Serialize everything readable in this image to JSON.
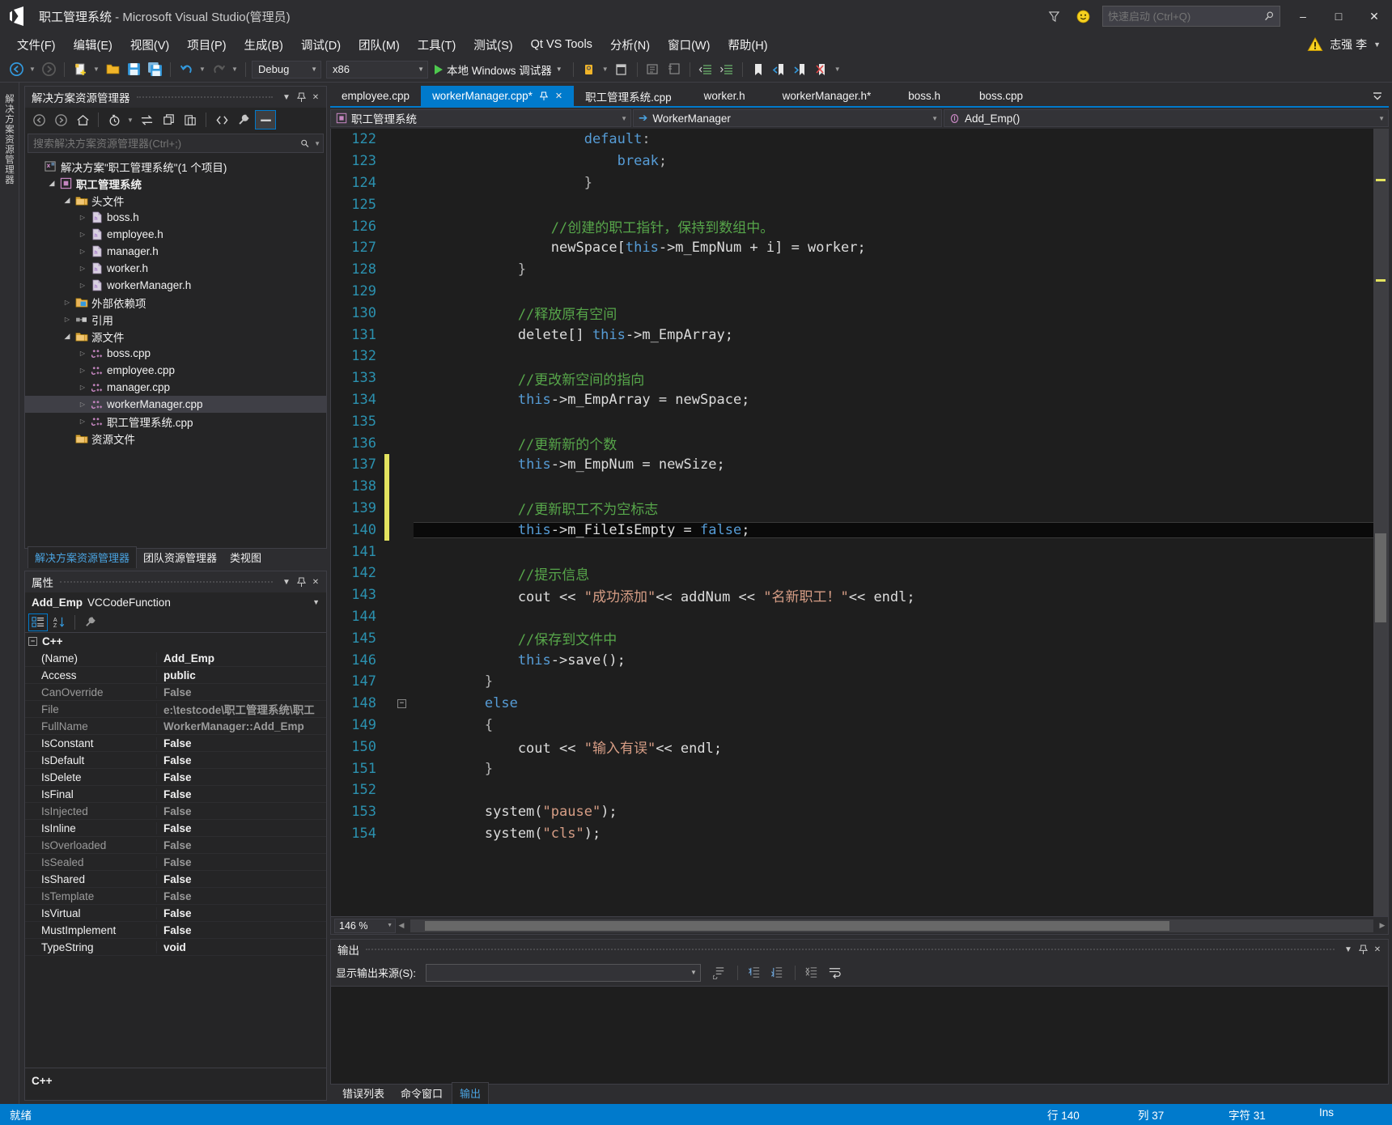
{
  "window": {
    "title_project": "职工管理系统",
    "title_suffix": " - Microsoft Visual Studio(管理员)",
    "minimize": "–",
    "maximize": "□",
    "close": "✕"
  },
  "quick_launch": {
    "placeholder": "快速启动 (Ctrl+Q)",
    "value": ""
  },
  "menu": {
    "items": [
      {
        "label": "文件(F)"
      },
      {
        "label": "编辑(E)"
      },
      {
        "label": "视图(V)"
      },
      {
        "label": "项目(P)"
      },
      {
        "label": "生成(B)"
      },
      {
        "label": "调试(D)"
      },
      {
        "label": "团队(M)"
      },
      {
        "label": "工具(T)"
      },
      {
        "label": "测试(S)"
      },
      {
        "label": "Qt VS Tools"
      },
      {
        "label": "分析(N)"
      },
      {
        "label": "窗口(W)"
      },
      {
        "label": "帮助(H)"
      }
    ],
    "user": "志强 李"
  },
  "toolbar": {
    "config": "Debug",
    "platform": "x86",
    "debug_target": "本地 Windows 调试器"
  },
  "solution_explorer": {
    "title": "解决方案资源管理器",
    "search_placeholder": "搜索解决方案资源管理器(Ctrl+;)",
    "search_value": "",
    "tree": [
      {
        "label": "解决方案\"职工管理系统\"(1 个项目)",
        "indent": 0,
        "arrow": "",
        "icon": "solution",
        "bold": false
      },
      {
        "label": "职工管理系统",
        "indent": 1,
        "arrow": "down",
        "icon": "project",
        "bold": true
      },
      {
        "label": "头文件",
        "indent": 2,
        "arrow": "down",
        "icon": "folder",
        "bold": false
      },
      {
        "label": "boss.h",
        "indent": 3,
        "arrow": "right",
        "icon": "header",
        "bold": false
      },
      {
        "label": "employee.h",
        "indent": 3,
        "arrow": "right",
        "icon": "header",
        "bold": false
      },
      {
        "label": "manager.h",
        "indent": 3,
        "arrow": "right",
        "icon": "header",
        "bold": false
      },
      {
        "label": "worker.h",
        "indent": 3,
        "arrow": "right",
        "icon": "header",
        "bold": false
      },
      {
        "label": "workerManager.h",
        "indent": 3,
        "arrow": "right",
        "icon": "header",
        "bold": false
      },
      {
        "label": "外部依赖项",
        "indent": 2,
        "arrow": "right",
        "icon": "extdep",
        "bold": false
      },
      {
        "label": "引用",
        "indent": 2,
        "arrow": "right",
        "icon": "refs",
        "bold": false
      },
      {
        "label": "源文件",
        "indent": 2,
        "arrow": "down",
        "icon": "folder",
        "bold": false
      },
      {
        "label": "boss.cpp",
        "indent": 3,
        "arrow": "right",
        "icon": "cpp",
        "bold": false
      },
      {
        "label": "employee.cpp",
        "indent": 3,
        "arrow": "right",
        "icon": "cpp",
        "bold": false
      },
      {
        "label": "manager.cpp",
        "indent": 3,
        "arrow": "right",
        "icon": "cpp",
        "bold": false
      },
      {
        "label": "workerManager.cpp",
        "indent": 3,
        "arrow": "right",
        "icon": "cpp",
        "bold": false,
        "selected": true
      },
      {
        "label": "职工管理系统.cpp",
        "indent": 3,
        "arrow": "right",
        "icon": "cpp",
        "bold": false
      },
      {
        "label": "资源文件",
        "indent": 2,
        "arrow": "",
        "icon": "folder",
        "bold": false
      }
    ],
    "dock_tabs": [
      {
        "label": "解决方案资源管理器",
        "active": true
      },
      {
        "label": "团队资源管理器",
        "active": false
      },
      {
        "label": "类视图",
        "active": false
      }
    ]
  },
  "properties": {
    "title": "属性",
    "object_name": "Add_Emp",
    "object_type": "VCCodeFunction",
    "category": "C++",
    "footer": "C++",
    "rows": [
      {
        "key": "(Name)",
        "value": "Add_Emp",
        "dim": false
      },
      {
        "key": "Access",
        "value": "public",
        "dim": false
      },
      {
        "key": "CanOverride",
        "value": "False",
        "dim": true
      },
      {
        "key": "File",
        "value": "e:\\testcode\\职工管理系统\\职工",
        "dim": true
      },
      {
        "key": "FullName",
        "value": "WorkerManager::Add_Emp",
        "dim": true
      },
      {
        "key": "IsConstant",
        "value": "False",
        "dim": false
      },
      {
        "key": "IsDefault",
        "value": "False",
        "dim": false
      },
      {
        "key": "IsDelete",
        "value": "False",
        "dim": false
      },
      {
        "key": "IsFinal",
        "value": "False",
        "dim": false
      },
      {
        "key": "IsInjected",
        "value": "False",
        "dim": true
      },
      {
        "key": "IsInline",
        "value": "False",
        "dim": false
      },
      {
        "key": "IsOverloaded",
        "value": "False",
        "dim": true
      },
      {
        "key": "IsSealed",
        "value": "False",
        "dim": true
      },
      {
        "key": "IsShared",
        "value": "False",
        "dim": false
      },
      {
        "key": "IsTemplate",
        "value": "False",
        "dim": true
      },
      {
        "key": "IsVirtual",
        "value": "False",
        "dim": false
      },
      {
        "key": "MustImplement",
        "value": "False",
        "dim": false
      },
      {
        "key": "TypeString",
        "value": "void",
        "dim": false
      }
    ]
  },
  "editor": {
    "tabs": [
      {
        "label": "employee.cpp",
        "active": false,
        "dirty": false
      },
      {
        "label": "workerManager.cpp*",
        "active": true,
        "dirty": true
      },
      {
        "label": "职工管理系统.cpp",
        "active": false,
        "dirty": false
      },
      {
        "label": "worker.h",
        "active": false,
        "dirty": false
      },
      {
        "label": "workerManager.h*",
        "active": false,
        "dirty": true
      },
      {
        "label": "boss.h",
        "active": false,
        "dirty": false
      },
      {
        "label": "boss.cpp",
        "active": false,
        "dirty": false
      }
    ],
    "nav_project": "职工管理系统",
    "nav_class": "WorkerManager",
    "nav_member": "Add_Emp()",
    "zoom": "146 %",
    "first_line": 122,
    "current_line": 140,
    "lines": [
      {
        "n": 122,
        "tokens": [
          {
            "t": "                    ",
            "c": "pl"
          },
          {
            "t": "default",
            "c": "kw"
          },
          {
            "t": ":",
            "c": "op"
          }
        ]
      },
      {
        "n": 123,
        "tokens": [
          {
            "t": "                        ",
            "c": "pl"
          },
          {
            "t": "break",
            "c": "kw"
          },
          {
            "t": ";",
            "c": "op"
          }
        ]
      },
      {
        "n": 124,
        "tokens": [
          {
            "t": "                    }",
            "c": "op"
          }
        ]
      },
      {
        "n": 125,
        "tokens": []
      },
      {
        "n": 126,
        "tokens": [
          {
            "t": "                //创建的职工指针，保持到数组中。",
            "c": "cm"
          }
        ]
      },
      {
        "n": 127,
        "tokens": [
          {
            "t": "                newSpace[",
            "c": "pl"
          },
          {
            "t": "this",
            "c": "kw"
          },
          {
            "t": "->m_EmpNum + i] = worker;",
            "c": "pl"
          }
        ]
      },
      {
        "n": 128,
        "tokens": [
          {
            "t": "            }",
            "c": "op"
          }
        ]
      },
      {
        "n": 129,
        "tokens": []
      },
      {
        "n": 130,
        "tokens": [
          {
            "t": "            //释放原有空间",
            "c": "cm"
          }
        ]
      },
      {
        "n": 131,
        "tokens": [
          {
            "t": "            delete[] ",
            "c": "pl"
          },
          {
            "t": "this",
            "c": "kw"
          },
          {
            "t": "->m_EmpArray;",
            "c": "pl"
          }
        ]
      },
      {
        "n": 132,
        "tokens": []
      },
      {
        "n": 133,
        "tokens": [
          {
            "t": "            //更改新空间的指向",
            "c": "cm"
          }
        ]
      },
      {
        "n": 134,
        "tokens": [
          {
            "t": "            ",
            "c": "pl"
          },
          {
            "t": "this",
            "c": "kw"
          },
          {
            "t": "->m_EmpArray = newSpace;",
            "c": "pl"
          }
        ]
      },
      {
        "n": 135,
        "tokens": []
      },
      {
        "n": 136,
        "tokens": [
          {
            "t": "            //更新新的个数",
            "c": "cm"
          }
        ]
      },
      {
        "n": 137,
        "tokens": [
          {
            "t": "            ",
            "c": "pl"
          },
          {
            "t": "this",
            "c": "kw"
          },
          {
            "t": "->m_EmpNum = newSize;",
            "c": "pl"
          }
        ],
        "changed": true
      },
      {
        "n": 138,
        "tokens": [],
        "changed": true
      },
      {
        "n": 139,
        "tokens": [
          {
            "t": "            //更新职工不为空标志",
            "c": "cm"
          }
        ],
        "changed": true
      },
      {
        "n": 140,
        "tokens": [
          {
            "t": "            ",
            "c": "pl"
          },
          {
            "t": "this",
            "c": "kw"
          },
          {
            "t": "->m_FileIsEmpty = ",
            "c": "pl"
          },
          {
            "t": "false",
            "c": "kw"
          },
          {
            "t": ";",
            "c": "pl"
          }
        ],
        "changed": true,
        "current": true
      },
      {
        "n": 141,
        "tokens": []
      },
      {
        "n": 142,
        "tokens": [
          {
            "t": "            //提示信息",
            "c": "cm"
          }
        ]
      },
      {
        "n": 143,
        "tokens": [
          {
            "t": "            cout << ",
            "c": "pl"
          },
          {
            "t": "\"成功添加\"",
            "c": "st"
          },
          {
            "t": "<< addNum << ",
            "c": "pl"
          },
          {
            "t": "\"名新职工！\"",
            "c": "st"
          },
          {
            "t": "<< endl;",
            "c": "pl"
          }
        ]
      },
      {
        "n": 144,
        "tokens": []
      },
      {
        "n": 145,
        "tokens": [
          {
            "t": "            //保存到文件中",
            "c": "cm"
          }
        ]
      },
      {
        "n": 146,
        "tokens": [
          {
            "t": "            ",
            "c": "pl"
          },
          {
            "t": "this",
            "c": "kw"
          },
          {
            "t": "->save();",
            "c": "pl"
          }
        ]
      },
      {
        "n": 147,
        "tokens": [
          {
            "t": "        }",
            "c": "op"
          }
        ]
      },
      {
        "n": 148,
        "tokens": [
          {
            "t": "        ",
            "c": "pl"
          },
          {
            "t": "else",
            "c": "kw"
          }
        ],
        "fold": true
      },
      {
        "n": 149,
        "tokens": [
          {
            "t": "        {",
            "c": "op"
          }
        ]
      },
      {
        "n": 150,
        "tokens": [
          {
            "t": "            cout << ",
            "c": "pl"
          },
          {
            "t": "\"输入有误\"",
            "c": "st"
          },
          {
            "t": "<< endl;",
            "c": "pl"
          }
        ]
      },
      {
        "n": 151,
        "tokens": [
          {
            "t": "        }",
            "c": "op"
          }
        ]
      },
      {
        "n": 152,
        "tokens": []
      },
      {
        "n": 153,
        "tokens": [
          {
            "t": "        system(",
            "c": "pl"
          },
          {
            "t": "\"pause\"",
            "c": "st"
          },
          {
            "t": ");",
            "c": "pl"
          }
        ]
      },
      {
        "n": 154,
        "tokens": [
          {
            "t": "        system(",
            "c": "pl"
          },
          {
            "t": "\"cls\"",
            "c": "st"
          },
          {
            "t": ");",
            "c": "pl"
          }
        ]
      }
    ]
  },
  "output": {
    "title": "输出",
    "source_label": "显示输出来源(S):",
    "source_value": "",
    "tabs": [
      {
        "label": "错误列表",
        "active": false
      },
      {
        "label": "命令窗口",
        "active": false
      },
      {
        "label": "输出",
        "active": true
      }
    ]
  },
  "status": {
    "ready": "就绪",
    "line": "行 140",
    "col": "列 37",
    "char": "字符 31",
    "ins": "Ins"
  },
  "colors": {
    "accent": "#007acc",
    "keyword": "#569cd6",
    "comment": "#57a64a",
    "string": "#d69d85",
    "linenum": "#2b91af",
    "change_bar": "#e3e35f"
  }
}
